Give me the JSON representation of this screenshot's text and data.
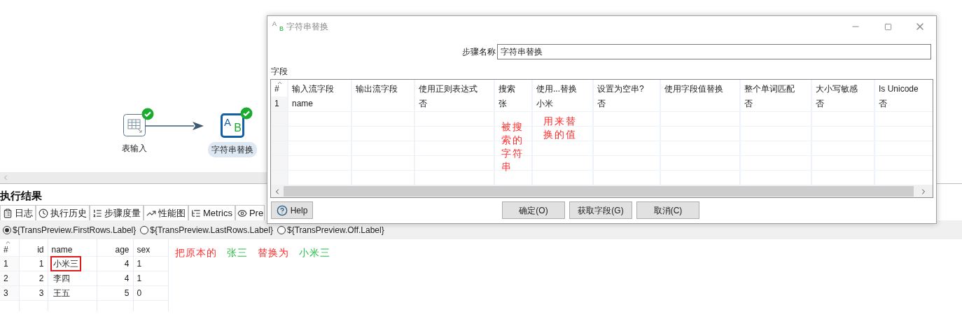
{
  "canvas": {
    "nodes": [
      {
        "label": "表输入",
        "kind": "table-input",
        "ok": true,
        "selected": false
      },
      {
        "label": "字符串替换",
        "kind": "replace",
        "ok": true,
        "selected": true,
        "glyphs": [
          "A",
          "B"
        ]
      }
    ]
  },
  "results": {
    "title": "执行结果",
    "tabs": [
      {
        "label": "日志"
      },
      {
        "label": "执行历史"
      },
      {
        "label": "步骤度量"
      },
      {
        "label": "性能图"
      },
      {
        "label": "Metrics"
      },
      {
        "label": "Pre"
      }
    ],
    "preview_modes": [
      {
        "label": "${TransPreview.FirstRows.Label}",
        "selected": true
      },
      {
        "label": "${TransPreview.LastRows.Label}",
        "selected": false
      },
      {
        "label": "${TransPreview.Off.Label}",
        "selected": false
      }
    ],
    "table": {
      "columns": [
        "#",
        "id",
        "name",
        "age",
        "sex"
      ],
      "rows": [
        {
          "cells": [
            "1",
            "1",
            "小米三",
            "4",
            "1"
          ],
          "marked": true
        },
        {
          "cells": [
            "2",
            "2",
            "李四",
            "4",
            "1"
          ],
          "marked": false
        },
        {
          "cells": [
            "3",
            "3",
            "王五",
            "5",
            "0"
          ],
          "marked": false
        }
      ]
    },
    "annotation": {
      "parts": [
        {
          "text": "把原本的",
          "color": "#ff2d2d"
        },
        {
          "text": "张三",
          "color": "#2dbf4a"
        },
        {
          "text": "替换为",
          "color": "#ff2d2d"
        },
        {
          "text": "小米三",
          "color": "#2dbf4a"
        }
      ]
    }
  },
  "dialog": {
    "title": "字符串替换",
    "icon_glyphs": [
      "A",
      "B"
    ],
    "step_name_label": "步骤名称",
    "step_name": "字符串替换",
    "fields_label": "字段",
    "columns": [
      "#",
      "输入流字段",
      "输出流字段",
      "使用正则表达式",
      "搜索",
      "使用...替换",
      "设置为空串?",
      "使用字段值替换",
      "整个单词匹配",
      "大小写敏感",
      "Is Unicode"
    ],
    "rows": [
      [
        "1",
        "name",
        null,
        "否",
        "张",
        "小米",
        "否",
        null,
        "否",
        "否",
        "否"
      ]
    ],
    "notes": [
      "被搜索的字符串",
      "用来替换的值"
    ],
    "buttons": [
      {
        "label": "Help",
        "kind": "help"
      },
      {
        "label": "确定(O)",
        "kind": "plain"
      },
      {
        "label": "获取字段(G)",
        "kind": "plain"
      },
      {
        "label": "取消(C)",
        "kind": "plain"
      }
    ]
  }
}
